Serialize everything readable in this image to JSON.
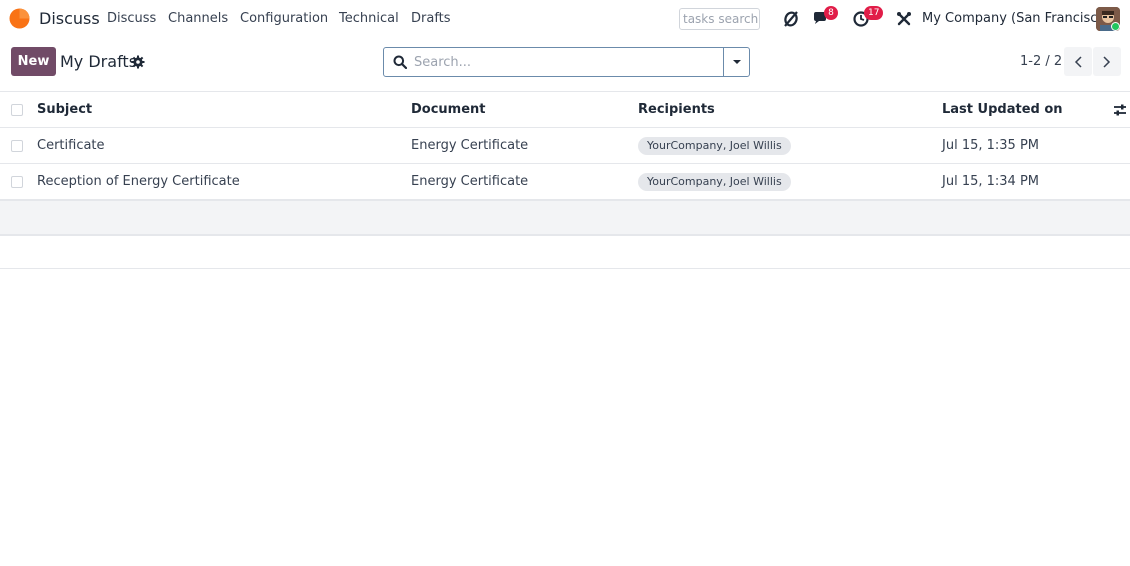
{
  "navbar": {
    "app_name": "Discuss",
    "menu": [
      "Discuss",
      "Channels",
      "Configuration",
      "Technical",
      "Drafts"
    ],
    "tasks_search_placeholder": "tasks search",
    "messages_count": "8",
    "activities_count": "17",
    "company": "My Company (San Francisco)"
  },
  "control_panel": {
    "new_label": "New",
    "title": "My Drafts",
    "search_placeholder": "Search...",
    "pager": "1-2 / 2"
  },
  "table": {
    "columns": [
      "Subject",
      "Document",
      "Recipients",
      "Last Updated on"
    ],
    "rows": [
      {
        "subject": "Certificate",
        "document": "Energy Certificate",
        "recipients": "YourCompany, Joel Willis",
        "updated": "Jul 15, 1:35 PM"
      },
      {
        "subject": "Reception of Energy Certificate",
        "document": "Energy Certificate",
        "recipients": "YourCompany, Joel Willis",
        "updated": "Jul 15, 1:34 PM"
      }
    ]
  },
  "colors": {
    "brand": "#714b67",
    "badge": "#e11d48",
    "logo": "#f97316"
  }
}
